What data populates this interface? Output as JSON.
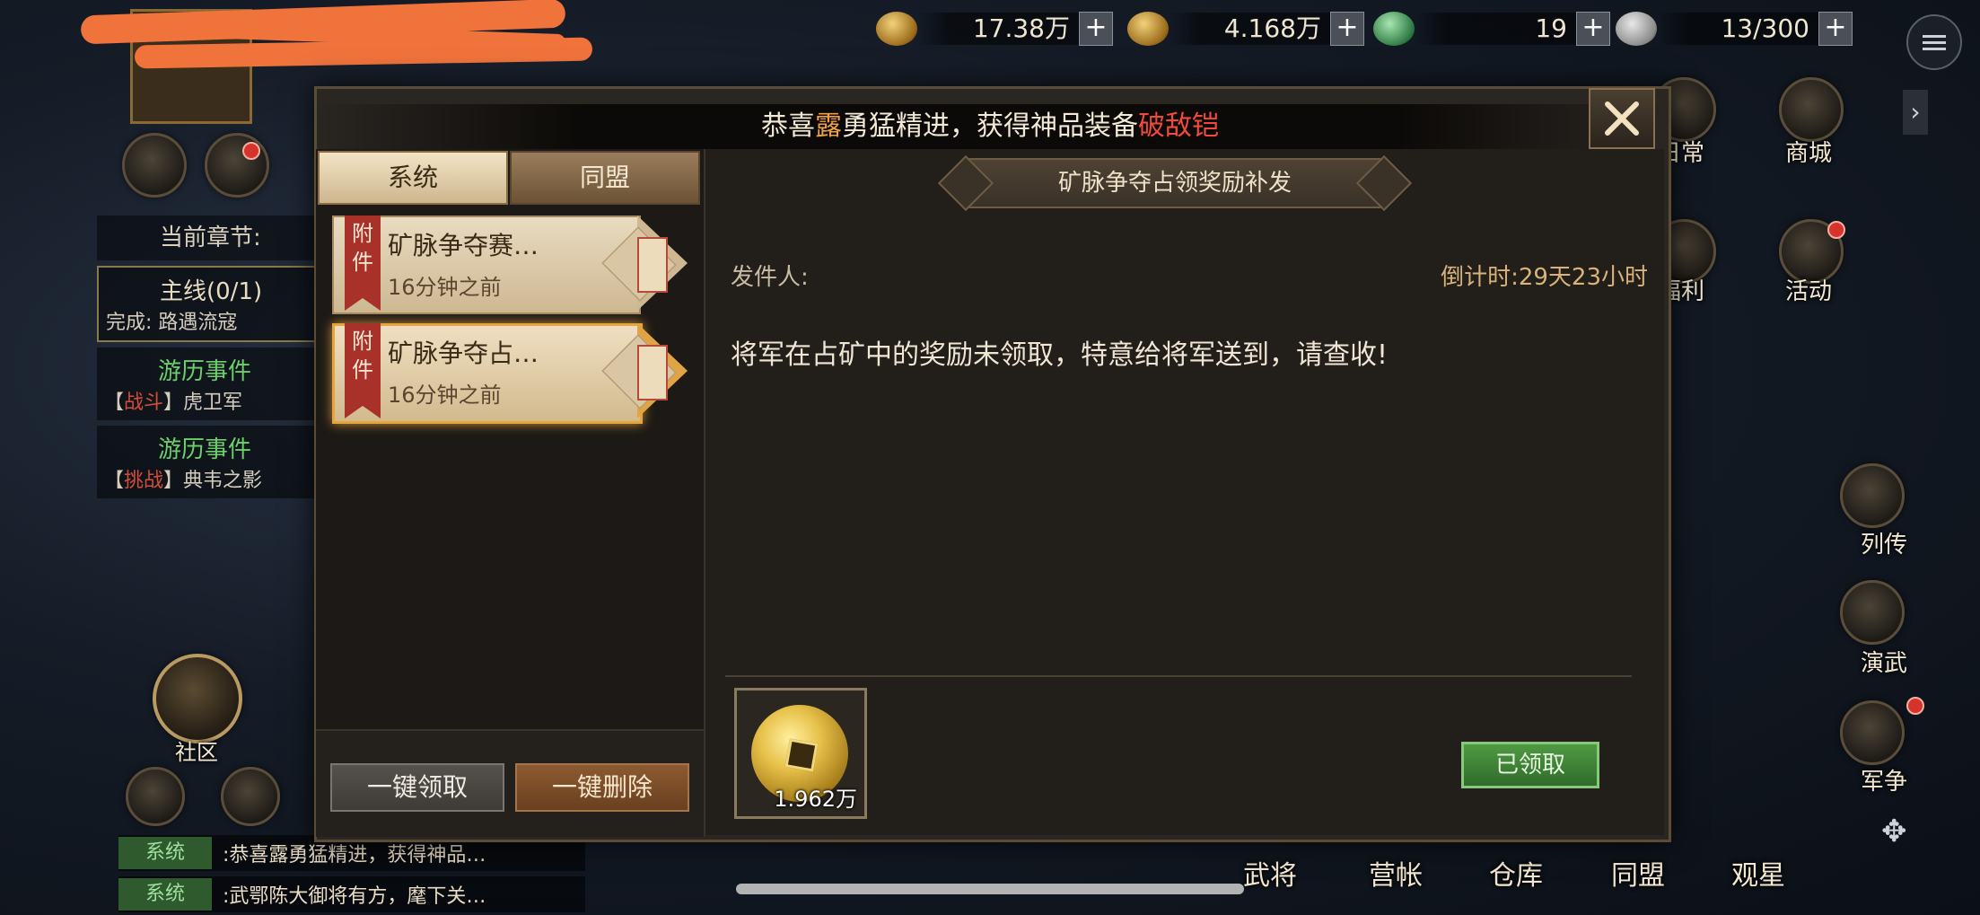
{
  "hud": {
    "resources": [
      {
        "name": "copper-coins",
        "value": "17.38万"
      },
      {
        "name": "gold-coin",
        "value": "4.168万"
      },
      {
        "name": "jade",
        "value": "19"
      },
      {
        "name": "stone",
        "value": "13/300"
      }
    ],
    "plus": "+"
  },
  "right_menu": [
    {
      "label": "日常"
    },
    {
      "label": "商城"
    },
    {
      "label": "福利"
    },
    {
      "label": "活动"
    },
    {
      "label": "列传"
    },
    {
      "label": "演武"
    },
    {
      "label": "军争"
    }
  ],
  "quest_panel": {
    "header": "当前章节:",
    "main": {
      "title": "主线(0/1)",
      "sub": "完成: 路遇流寇"
    },
    "events": [
      {
        "title": "游历事件",
        "tag": "战斗",
        "name": "虎卫军"
      },
      {
        "title": "游历事件",
        "tag": "挑战",
        "name": "典韦之影"
      }
    ]
  },
  "left_bottom": {
    "community_label": "社区"
  },
  "chat": [
    {
      "badge": "系统",
      "text": ":恭喜露勇猛精进，获得神品…"
    },
    {
      "badge": "系统",
      "text": ":武鄂陈大御将有方，麾下关…"
    }
  ],
  "bottom_nav": [
    "武将",
    "营帐",
    "仓库",
    "同盟",
    "观星"
  ],
  "banner": {
    "prefix": "恭喜",
    "name": "露",
    "middle": "勇猛精进，获得神品装备",
    "item": "破敌铠"
  },
  "mail": {
    "tabs": [
      "系统",
      "同盟"
    ],
    "items": [
      {
        "ribbon": "附件",
        "title": "矿脉争夺赛…",
        "time": "16分钟之前"
      },
      {
        "ribbon": "附件",
        "title": "矿脉争夺占…",
        "time": "16分钟之前"
      }
    ],
    "actions": {
      "claim_all": "一键领取",
      "delete_all": "一键删除"
    },
    "detail": {
      "subject": "矿脉争夺占领奖励补发",
      "sender": "发件人:",
      "countdown": "倒计时:29天23小时",
      "message": "将军在占矿中的奖励未领取，特意给将军送到，请查收!",
      "reward_qty": "1.962万",
      "claimed": "已领取"
    }
  },
  "colors": {
    "accent_gold": "#e7a43c",
    "highlight_orange": "#f0a040",
    "highlight_red": "#f04a3a",
    "claimed_green": "#4f9a44"
  }
}
